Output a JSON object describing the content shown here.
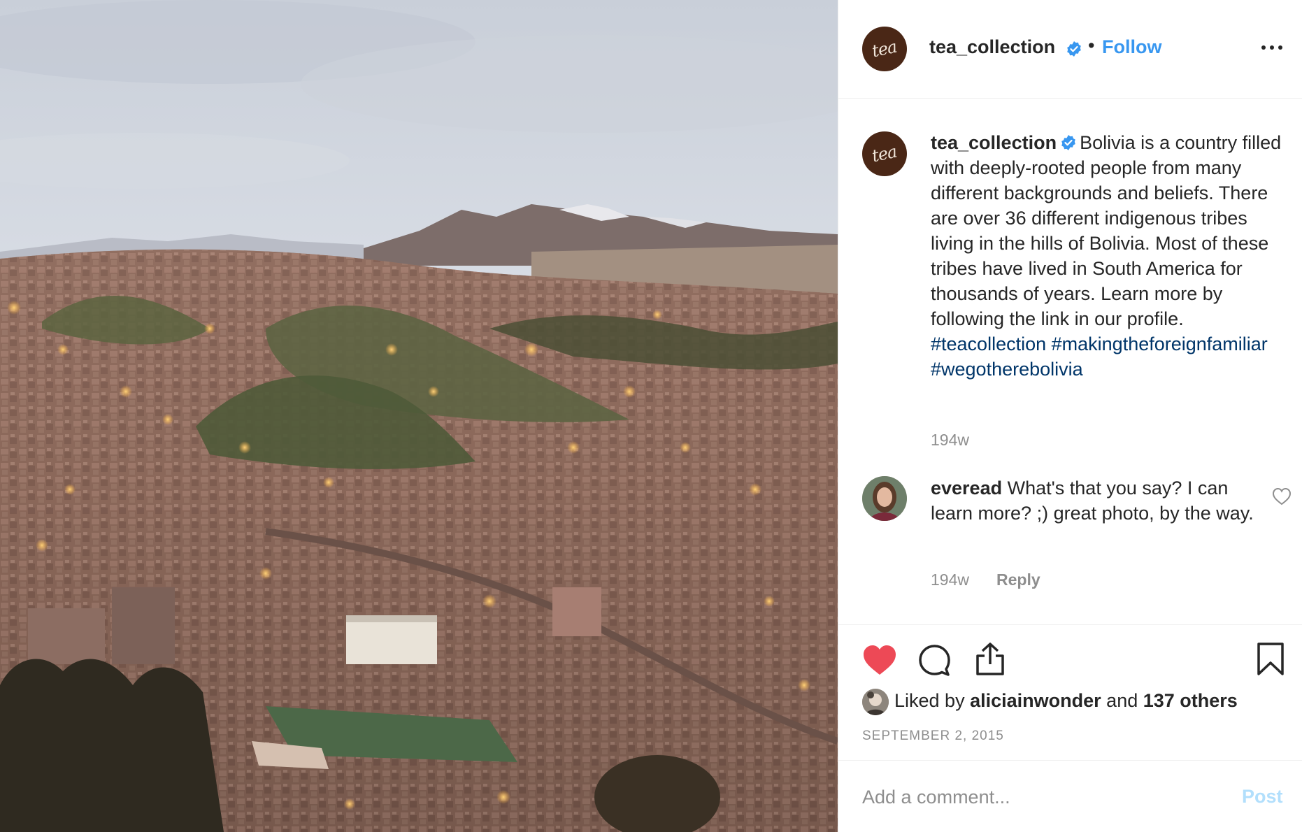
{
  "post": {
    "image_alt": "",
    "author": {
      "username": "tea_collection",
      "avatar_text": "tea",
      "verified": true
    },
    "follow_label": "Follow",
    "header_separator": "•",
    "caption": {
      "username": "tea_collection",
      "text": "Bolivia is a country filled with deeply-rooted people from many different backgrounds and beliefs. There are over 36 different indigenous tribes living in the hills of Bolivia. Most of these tribes have lived in South America for thousands of years. Learn more by following the link in our profile.",
      "hashtags": [
        "#teacollection",
        "#makingtheforeignfamiliar",
        "#wegotherebolivia"
      ],
      "time_ago": "194w"
    },
    "comments": [
      {
        "username": "everead",
        "text": "What's that you say? I can learn more? ;) great photo, by the way.",
        "time_ago": "194w",
        "reply_label": "Reply"
      }
    ],
    "likes": {
      "prefix": "Liked by",
      "first_liker": "aliciainwonder",
      "joiner": "and",
      "others": "137 others"
    },
    "date": "SEPTEMBER 2, 2015",
    "add_comment": {
      "placeholder": "Add a comment...",
      "post_label": "Post"
    }
  },
  "colors": {
    "accent": "#3897f0",
    "hashtag": "#003569",
    "muted": "#8e8e8e",
    "like_red": "#ed4956",
    "verified_blue": "#3897f0",
    "post_disabled": "#b2dffc"
  },
  "icons": [
    "more-options-icon",
    "verified-badge-icon",
    "heart-outline-icon",
    "heart-filled-icon",
    "comment-icon",
    "share-icon",
    "bookmark-icon"
  ]
}
